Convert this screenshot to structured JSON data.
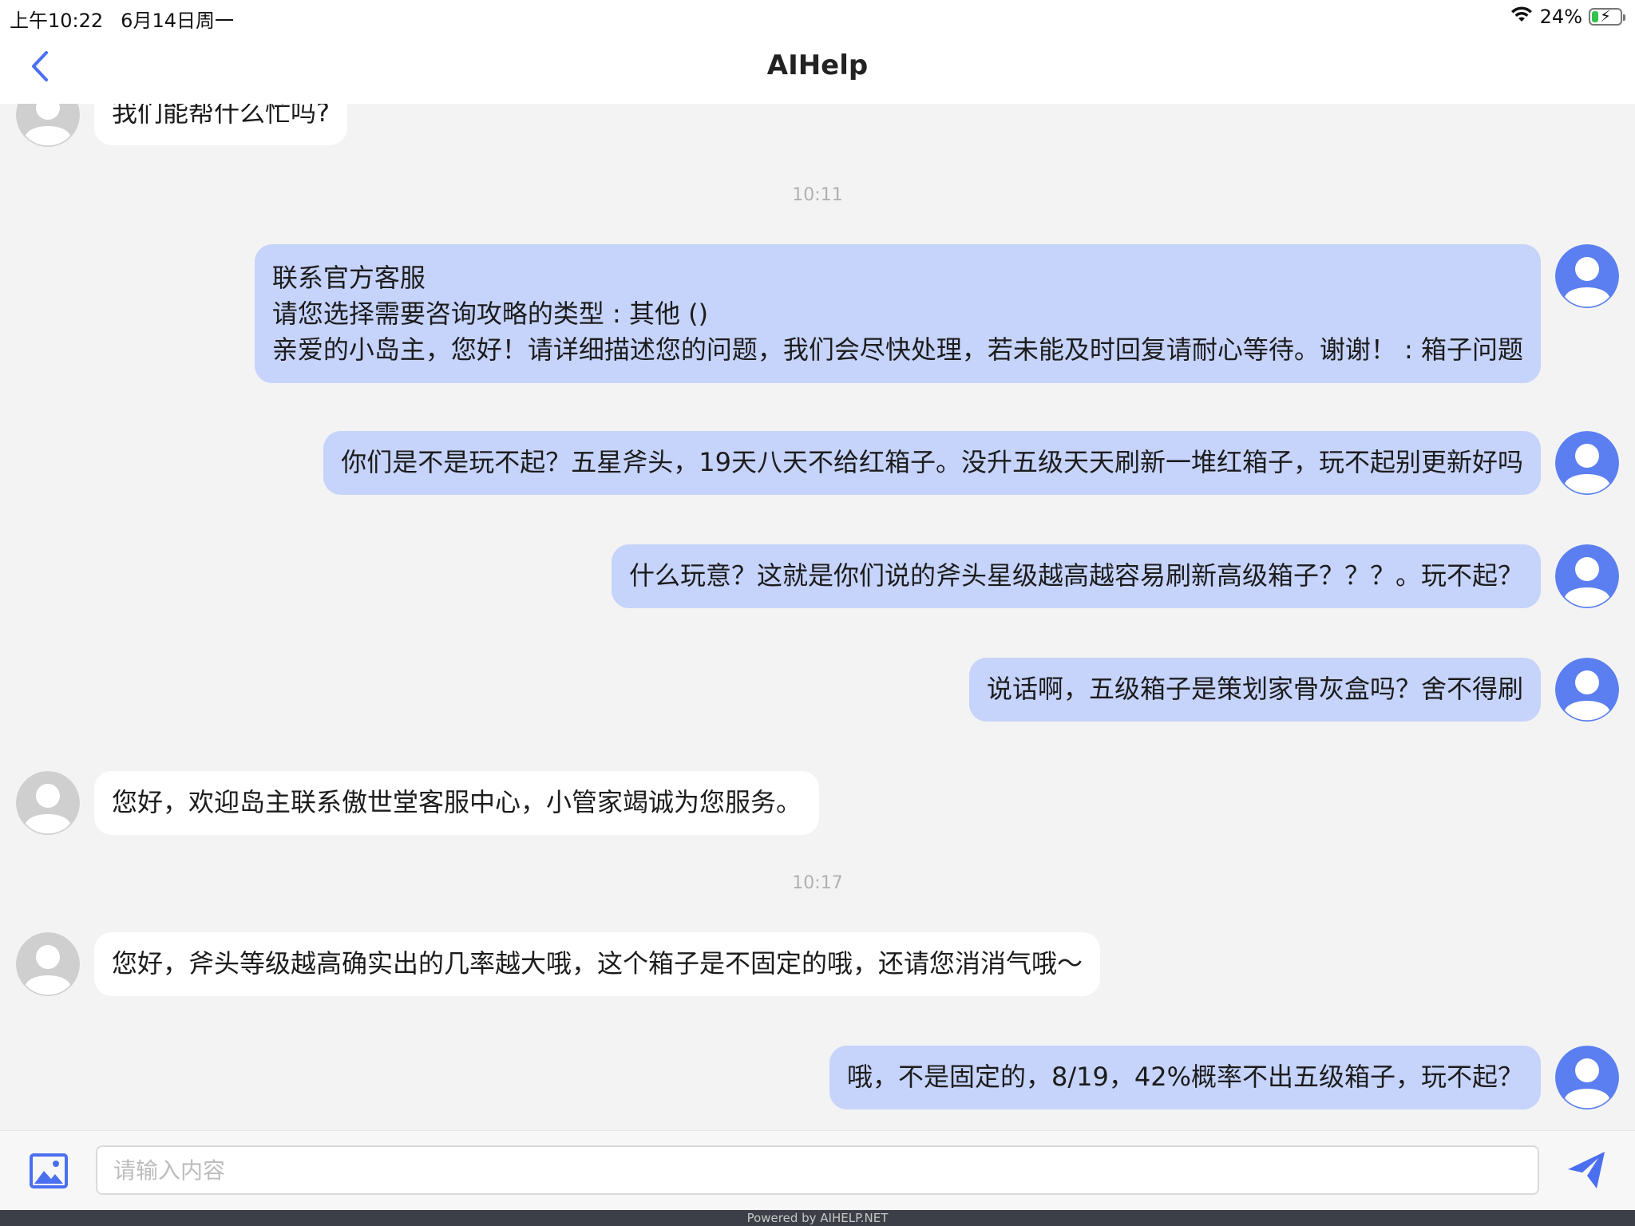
{
  "status_bar": {
    "time": "上午10:22",
    "date": "6月14日周一",
    "battery_percent": "24%",
    "battery_level": 0.24,
    "icons": [
      "wifi-icon",
      "battery-charging-icon"
    ]
  },
  "header": {
    "title": "AIHelp",
    "back_icon": "chevron-left-icon"
  },
  "chat": {
    "timestamps": [
      "10:11",
      "10:17"
    ],
    "messages": [
      {
        "sender": "agent",
        "lines": [
          "我们能帮什么忙吗?"
        ]
      },
      {
        "sender": "user",
        "lines": [
          "联系官方客服",
          "请您选择需要咨询攻略的类型 : 其他 ()",
          "亲爱的小岛主，您好！请详细描述您的问题，我们会尽快处理，若未能及时回复请耐心等待。谢谢！ : 箱子问题"
        ]
      },
      {
        "sender": "user",
        "lines": [
          "你们是不是玩不起？五星斧头，19天八天不给红箱子。没升五级天天刷新一堆红箱子，玩不起别更新好吗"
        ]
      },
      {
        "sender": "user",
        "lines": [
          "什么玩意？这就是你们说的斧头星级越高越容易刷新高级箱子？？？。玩不起？"
        ]
      },
      {
        "sender": "user",
        "lines": [
          "说话啊，五级箱子是策划家骨灰盒吗？舍不得刷"
        ]
      },
      {
        "sender": "agent",
        "lines": [
          "您好，欢迎岛主联系傲世堂客服中心，小管家竭诚为您服务。"
        ]
      },
      {
        "sender": "agent",
        "lines": [
          "您好，斧头等级越高确实出的几率越大哦，这个箱子是不固定的哦，还请您消消气哦～"
        ]
      },
      {
        "sender": "user",
        "lines": [
          "哦，不是固定的，8/19，42%概率不出五级箱子，玩不起？"
        ]
      }
    ]
  },
  "input": {
    "placeholder": "请输入内容",
    "value": "",
    "image_icon": "image-icon",
    "send_icon": "send-icon"
  },
  "footer": {
    "text": "Powered by AIHELP.NET"
  },
  "colors": {
    "user_bubble": "#c6d3fb",
    "agent_bubble": "#ffffff",
    "user_avatar": "#5b7ff0",
    "agent_avatar": "#cfcfcf",
    "accent": "#4a6ff0",
    "background": "#f3f3f3"
  }
}
